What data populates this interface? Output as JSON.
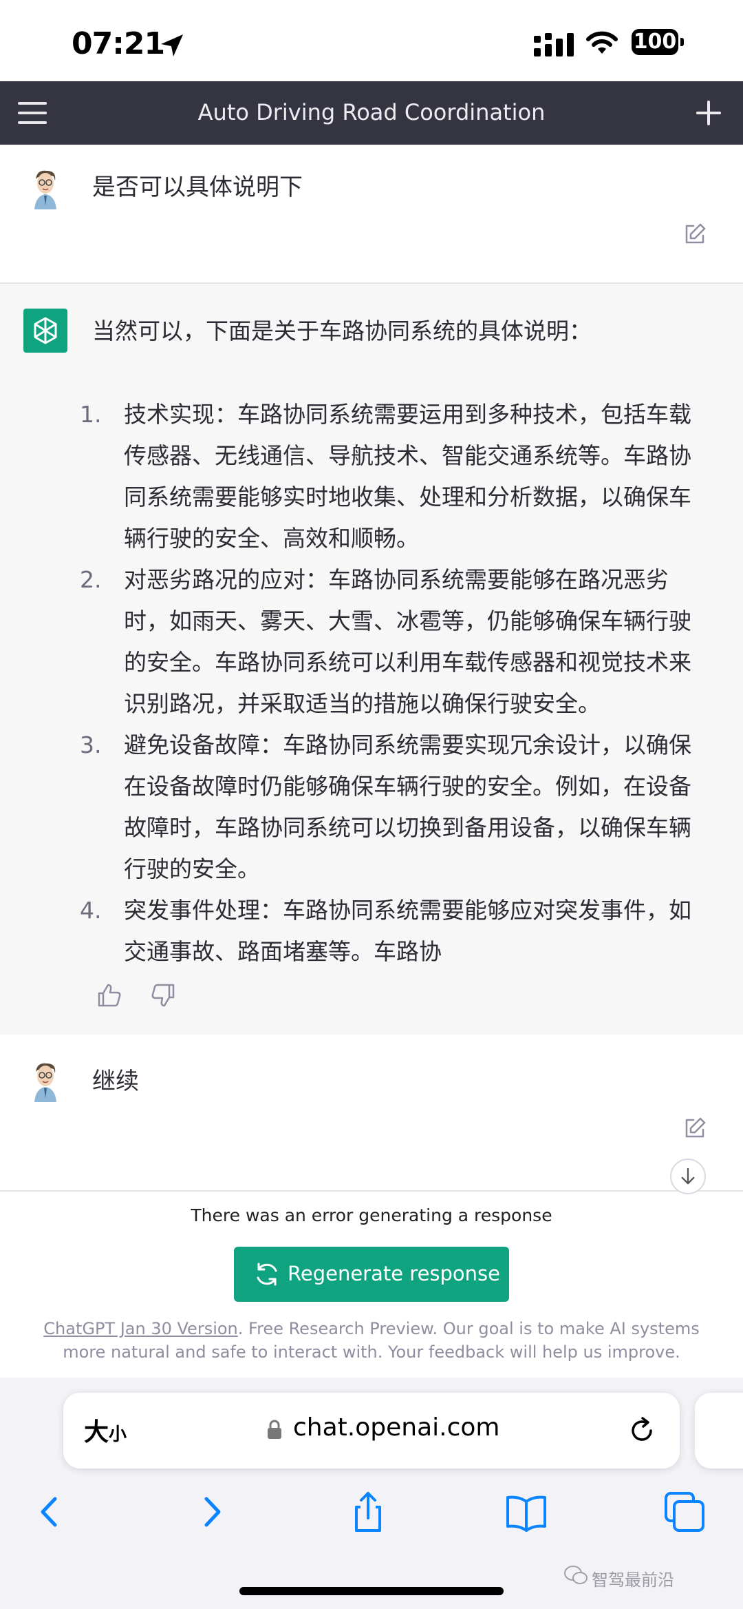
{
  "status_bar": {
    "time": "07:21",
    "battery": "100"
  },
  "header": {
    "title": "Auto Driving Road Coordination"
  },
  "messages": {
    "user1": "是否可以具体说明下",
    "bot_intro": "当然可以，下面是关于车路协同系统的具体说明：",
    "bot_items": [
      {
        "num": "1.",
        "text": "技术实现：车路协同系统需要运用到多种技术，包括车载传感器、无线通信、导航技术、智能交通系统等。车路协同系统需要能够实时地收集、处理和分析数据，以确保车辆行驶的安全、高效和顺畅。"
      },
      {
        "num": "2.",
        "text": "对恶劣路况的应对：车路协同系统需要能够在路况恶劣时，如雨天、雾天、大雪、冰雹等，仍能够确保车辆行驶的安全。车路协同系统可以利用车载传感器和视觉技术来识别路况，并采取适当的措施以确保行驶安全。"
      },
      {
        "num": "3.",
        "text": "避免设备故障：车路协同系统需要实现冗余设计，以确保在设备故障时仍能够确保车辆行驶的安全。例如，在设备故障时，车路协同系统可以切换到备用设备，以确保车辆行驶的安全。"
      },
      {
        "num": "4.",
        "text": "突发事件处理：车路协同系统需要能够应对突发事件，如交通事故、路面堵塞等。车路协"
      }
    ],
    "user2": "继续"
  },
  "bottom": {
    "error": "There was an error generating a response",
    "regenerate_label": "Regenerate response",
    "version_link": "ChatGPT Jan 30 Version",
    "footer_rest": ". Free Research Preview. Our goal is to make AI systems more natural and safe to interact with. Your feedback will help us improve."
  },
  "safari": {
    "text_size_big": "大",
    "text_size_small": "小",
    "url": "chat.openai.com"
  },
  "watermark": "智驾最前沿",
  "colors": {
    "header_bg": "#343541",
    "accent": "#10a37f",
    "safari_blue": "#0a84ff"
  },
  "icons": [
    "location-arrow-icon",
    "signal-icon",
    "wifi-icon",
    "battery-icon",
    "menu-icon",
    "plus-icon",
    "user-avatar",
    "openai-logo-icon",
    "edit-icon",
    "thumbs-up-icon",
    "thumbs-down-icon",
    "arrow-down-icon",
    "refresh-icon",
    "lock-icon",
    "reload-icon",
    "back-icon",
    "forward-icon",
    "share-icon",
    "bookmarks-icon",
    "tabs-icon",
    "wechat-icon"
  ]
}
